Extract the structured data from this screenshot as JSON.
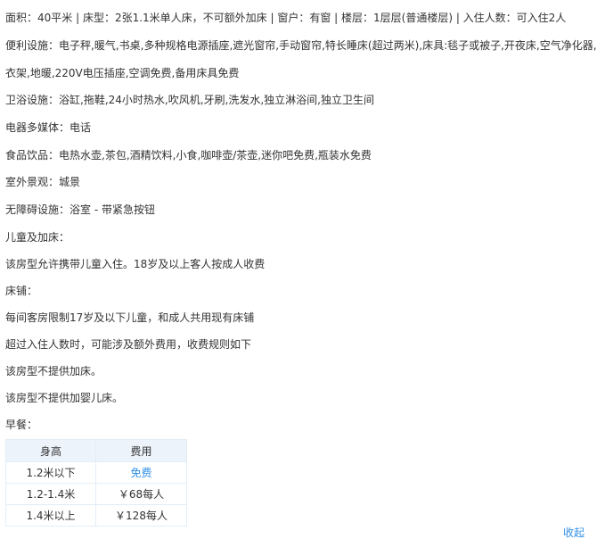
{
  "room_info": {
    "summary": "面积：40平米 | 床型：2张1.1米单人床，不可额外加床 | 窗户：有窗 | 楼层：1层层(普通楼层) | 入住人数：可入住2人",
    "amenities": "便利设施：电子秤,暖气,书桌,多种规格电源插座,遮光窗帘,手动窗帘,特长睡床(超过两米),床具:毯子或被子,开夜床,空气净化器,衣架,地暖,220V电压插座,空调免费,备用床具免费",
    "bathroom": "卫浴设施：浴缸,拖鞋,24小时热水,吹风机,牙刷,洗发水,独立淋浴间,独立卫生间",
    "media": "电器多媒体：电话",
    "food": "食品饮品：电热水壶,茶包,酒精饮料,小食,咖啡壶/茶壶,迷你吧免费,瓶装水免费",
    "view": "室外景观：城景",
    "accessibility": "无障碍设施：浴室 - 带紧急按钮"
  },
  "policy": {
    "children_title": "儿童及加床：",
    "children_text": "该房型允许携带儿童入住。18岁及以上客人按成人收费",
    "bed_title": "床铺：",
    "bed_text_1": "每间客房限制17岁及以下儿童，和成人共用现有床铺",
    "bed_text_2": "超过入住人数时，可能涉及额外费用，收费规则如下",
    "no_extra_bed": "该房型不提供加床。",
    "no_crib": "该房型不提供加婴儿床。",
    "breakfast_title": "早餐："
  },
  "breakfast_table": {
    "headers": [
      "身高",
      "费用"
    ],
    "rows": [
      [
        "1.2米以下",
        "免费"
      ],
      [
        "1.2-1.4米",
        "￥68每人"
      ],
      [
        "1.4米以上",
        "￥128每人"
      ]
    ]
  },
  "collapse_label": "收起",
  "colors": {
    "link": "#2f8fe8",
    "table_header_bg": "#edf3fb",
    "border": "#e3edf7"
  }
}
